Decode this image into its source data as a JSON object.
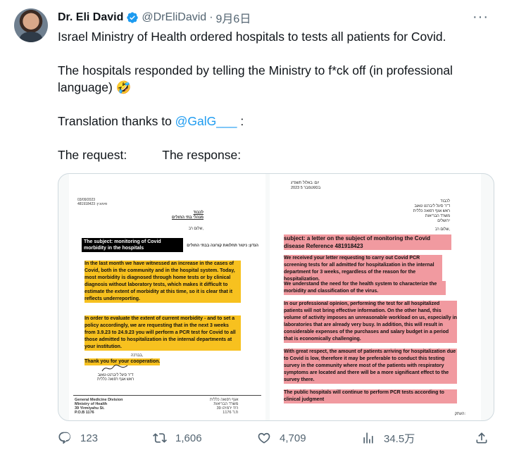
{
  "tweet": {
    "author_name": "Dr. Eli David",
    "handle": "@DrEliDavid",
    "separator": "·",
    "date": "9月6日",
    "more_label": "···",
    "line1": "Israel Ministry of Health ordered hospitals to tests all patients for Covid.",
    "line2": "The hospitals responded by telling the Ministry to f*ck off (in professional language) 🤣",
    "translation_prefix": "Translation thanks to ",
    "translation_mention": "@GalG___",
    "translation_suffix": " :",
    "request_label": "The request:",
    "response_label": "The response:"
  },
  "media": {
    "left_doc": {
      "date": "03/09/2023",
      "ref": "481918423 :סימוכין",
      "heb_addr": "לכבוד\nמנהלי בתי החולים",
      "heb_greeting": "שלום רב,",
      "heb_subject": "הנדון: ניטור תחלואת קורונה בבתי החולים",
      "subject": "The subject: monitoring of Covid morbidity in the hospitals",
      "para1": "In the last month we have witnessed an increase in the cases of Covid, both in the community and in the hospital system. Today, most morbidity is diagnosed through home tests or by clinical diagnosis without laboratory tests, which makes it difficult to estimate the extent of morbidity at this time, so it is clear that it reflects underreporting.",
      "para2": "In order to evaluate the extent of current morbidity - and to set a policy accordingly, we are requesting that in the next 3 weeks from 3.9.23 to 24.9.23 you will perform a PCR test for Covid to all those admitted to hospitalization in the internal departments at your institution.",
      "thanks": "Thank you for your cooperation.",
      "heb_regards": "בברכה,",
      "signature": "ד\"ר סיגל ליברנט-טאוב\nראש אגף רפואה כללית",
      "footer_en": "General Medicine Division\nMinistry of Health\n39 Yirmiyahu St.\nP.O.B 1176",
      "footer_heb": "אגף רפואה כללית\nמשרד הבריאות\nרח' ירמיהו 39\nת.ד 1176"
    },
    "right_doc": {
      "heb_date": "יום: באלול תשפ\"ג\n2023 בספטמבר 5",
      "heb_addr": "לכבוד\nד\"ר סיגל ליברנט טאוב\nראש אגף רפואה כללית\nמשרד הבריאות\nירושלים",
      "heb_greeting": "שלום רב,",
      "subject": "subject: a letter on the subject of monitoring the Covid disease Reference 481918423",
      "para1": "We received your letter requesting to carry out Covid PCR screening tests for all admitted for hospitalization in the internal department for 3 weeks, regardless of the reason for the hospitalization.",
      "para2": "We understand the need for the health system to characterize the morbidity and classification of the virus.",
      "para3": "In our professional opinion, performing the test for all hospitalized patients will not bring effective information. On the other hand, this volume of activity imposes an unreasonable workload on us, especially in laboratories that are already very busy. In addition, this will result in considerable expenses of the purchases and salary budget in a period that is economically challenging.",
      "para4": "With great respect, the amount of patients arriving for hospitalization due to Covid is low, therefore it may be preferable to conduct this testing survey in the community where most of the patients with respiratory symptoms are located and there will be a more significant effect to the survey there.",
      "para5": "The public hospitals will continue to perform PCR tests according to clinical judgment",
      "heb_footer": "העתק:"
    }
  },
  "actions": {
    "replies": "123",
    "retweets": "1,606",
    "likes": "4,709",
    "views": "34.5万"
  },
  "colors": {
    "accent": "#1d9bf0",
    "highlight_yellow": "#f7c11f",
    "highlight_red": "#f19aa0",
    "muted": "#536471"
  }
}
